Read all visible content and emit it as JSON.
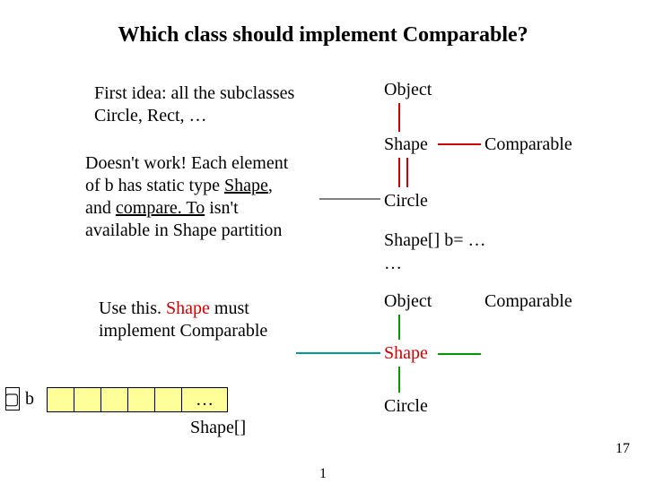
{
  "title": "Which class should implement Comparable?",
  "para1_a": "First idea: all the subclasses",
  "para1_b": "Circle, Rect, …",
  "para2_a": "Doesn't work! Each element",
  "para2_b_pre": "of b has static type ",
  "para2_b_shape": "Shape",
  "para2_b_post": ",",
  "para2_c_pre": "and ",
  "para2_c_mid": "compare. To",
  "para2_c_post": " isn't",
  "para2_d": "available in Shape partition",
  "para3_a_pre": "Use this. ",
  "para3_a_shape": "Shape",
  "para3_a_post": " must",
  "para3_b": "implement Comparable",
  "diag": {
    "object": "Object",
    "shape": "Shape",
    "comparable": "Comparable",
    "circle": "Circle",
    "code1": "Shape[] b= …",
    "code2": "…"
  },
  "arr": {
    "label": "b",
    "ellipsis": "…",
    "type": "Shape[]",
    "arrow": "▢"
  },
  "page_small": "17",
  "page_center": "1"
}
